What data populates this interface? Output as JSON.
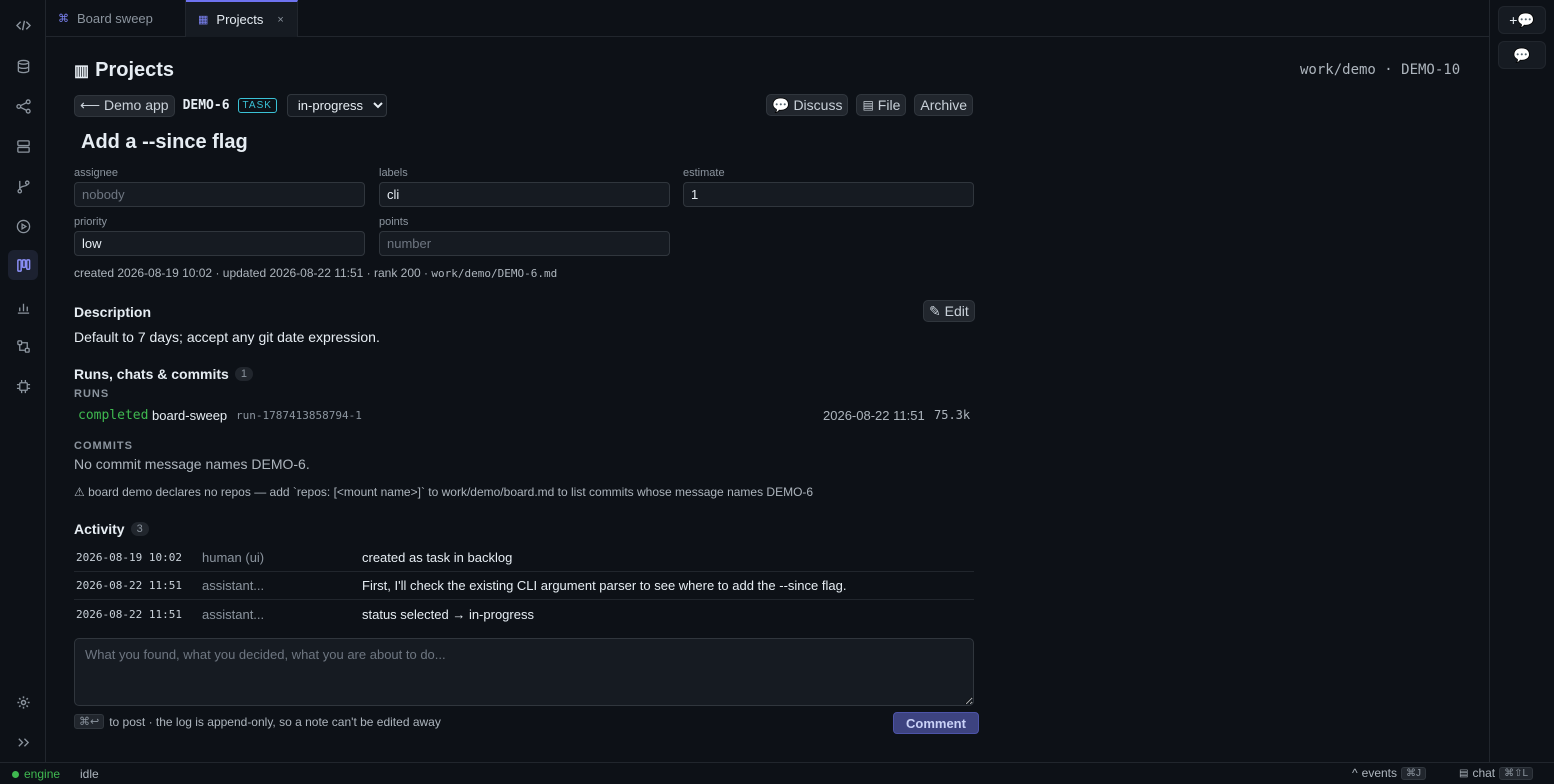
{
  "tabs": [
    {
      "label": "Board sweep",
      "icon": "command-icon"
    },
    {
      "label": "Projects",
      "icon": "board-icon",
      "close": "×"
    }
  ],
  "page": {
    "title": "Projects",
    "crumb_right": "work/demo · DEMO-10"
  },
  "toolbar": {
    "back_label": "⟵ Demo app",
    "task_id": "DEMO-6",
    "badge": "TASK",
    "status_selected": "in-progress",
    "discuss": "Discuss",
    "file": "File",
    "archive": "Archive"
  },
  "task": {
    "title": "Add a --since flag"
  },
  "fields": {
    "assignee": {
      "label": "assignee",
      "value": "",
      "placeholder": "nobody"
    },
    "labels": {
      "label": "labels",
      "value": "cli",
      "placeholder": ""
    },
    "estimate": {
      "label": "estimate",
      "value": "1",
      "placeholder": ""
    },
    "priority": {
      "label": "priority",
      "value": "low",
      "placeholder": ""
    },
    "points": {
      "label": "points",
      "value": "",
      "placeholder": "number"
    }
  },
  "meta": {
    "text": "created 2026-08-19 10:02 · updated 2026-08-22 11:51 · rank 200 · ",
    "path": "work/demo/DEMO-6.md"
  },
  "description": {
    "heading": "Description",
    "edit": "✎ Edit",
    "body": "Default to 7 days; accept any git date expression."
  },
  "runs_section": {
    "heading": "Runs, chats & commits",
    "count": "1",
    "runs_label": "RUNS",
    "run": {
      "status": "completed",
      "name": "board-sweep",
      "id": "run-1787413858794-1",
      "time": "2026-08-22 11:51",
      "tokens": "75.3k"
    },
    "commits_label": "COMMITS",
    "commits_empty": "No commit message names DEMO-6.",
    "warning": "⚠ board demo declares no repos — add `repos: [<mount name>]` to work/demo/board.md to list commits whose message names DEMO-6"
  },
  "activity": {
    "heading": "Activity",
    "count": "3",
    "rows": [
      {
        "time": "2026-08-19 10:02",
        "who": "human (ui)",
        "text": "created as task in backlog"
      },
      {
        "time": "2026-08-22 11:51",
        "who": "assistant...",
        "text": "First, I'll check the existing CLI argument parser to see where to add the --since flag."
      },
      {
        "time": "2026-08-22 11:51",
        "who": "assistant...",
        "text": "status selected → in-progress"
      }
    ]
  },
  "comment": {
    "placeholder": "What you found, what you decided, what you are about to do...",
    "kbd": "⌘↩",
    "hint": "to post · the log is append-only, so a note can't be edited away",
    "button": "Comment"
  },
  "status": {
    "engine": "engine",
    "state": "idle",
    "events": "events",
    "events_kbd": "⌘J",
    "chat": "chat",
    "chat_kbd": "⌘⇧L"
  },
  "colors": {
    "accent": "#6e73f0",
    "running": "#3fb950",
    "badge": "#3ac2d6"
  }
}
